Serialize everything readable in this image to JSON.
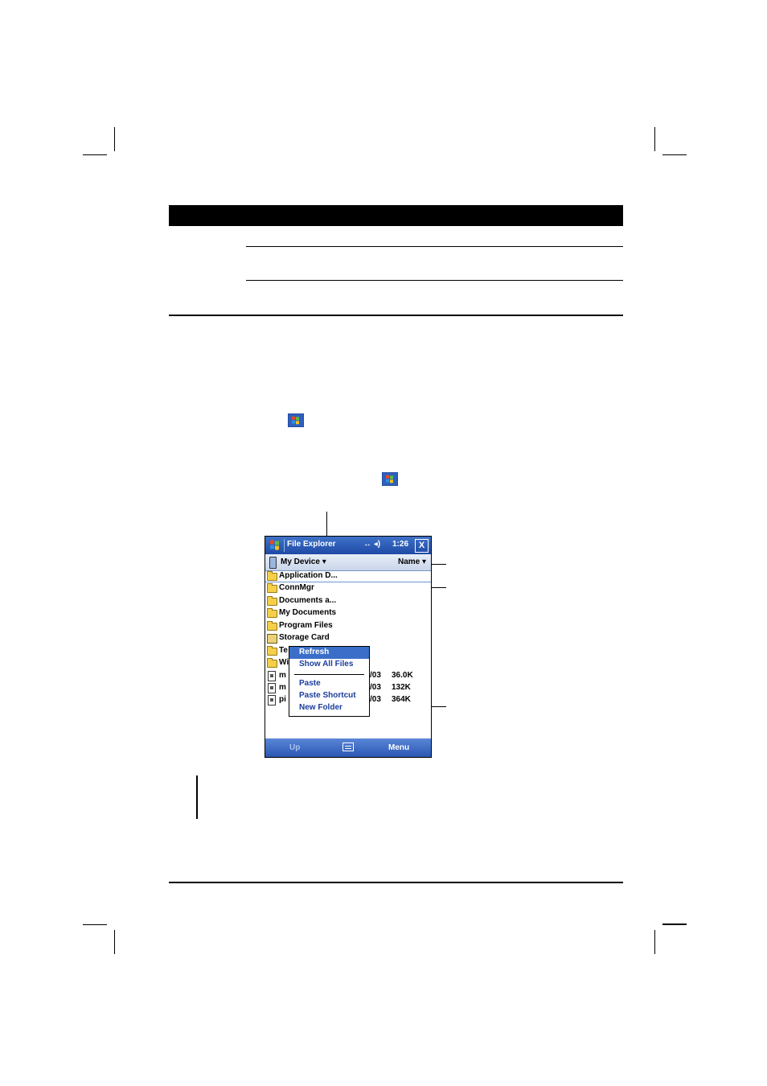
{
  "app": {
    "title": "File Explorer",
    "status_icons": "↔ ◂)",
    "time": "1:26",
    "close_glyph": "X"
  },
  "pathbar": {
    "location": "My Device",
    "location_arrow": "▾",
    "sort": "Name",
    "sort_arrow": "▾"
  },
  "files": [
    {
      "name": "Application D...",
      "icon": "folder-icon"
    },
    {
      "name": "ConnMgr",
      "icon": "folder-icon"
    },
    {
      "name": "Documents a...",
      "icon": "folder-icon"
    },
    {
      "name": "My Documents",
      "icon": "folder-icon"
    },
    {
      "name": "Program Files",
      "icon": "folder-icon"
    },
    {
      "name": "Storage Card",
      "icon": "storage-card-icon"
    },
    {
      "name": "Te",
      "icon": "folder-icon"
    },
    {
      "name": "Wi",
      "icon": "folder-icon"
    },
    {
      "name": "m",
      "icon": "file-icon",
      "date": "/03",
      "size": "36.0K"
    },
    {
      "name": "m",
      "icon": "file-icon",
      "date": "/03",
      "size": "132K"
    },
    {
      "name": "pi",
      "icon": "file-icon",
      "date": "/03",
      "size": "364K"
    }
  ],
  "context_menu": {
    "items": [
      "Refresh",
      "Show All Files",
      "Paste",
      "Paste Shortcut",
      "New Folder"
    ],
    "selected_index": 0
  },
  "softkeys": {
    "left": "Up",
    "right": "Menu"
  },
  "colors": {
    "titlebar": "#2553b0",
    "softbar": "#3a68c4",
    "menu_highlight": "#3a6ec9",
    "folder": "#f5cf4a"
  }
}
